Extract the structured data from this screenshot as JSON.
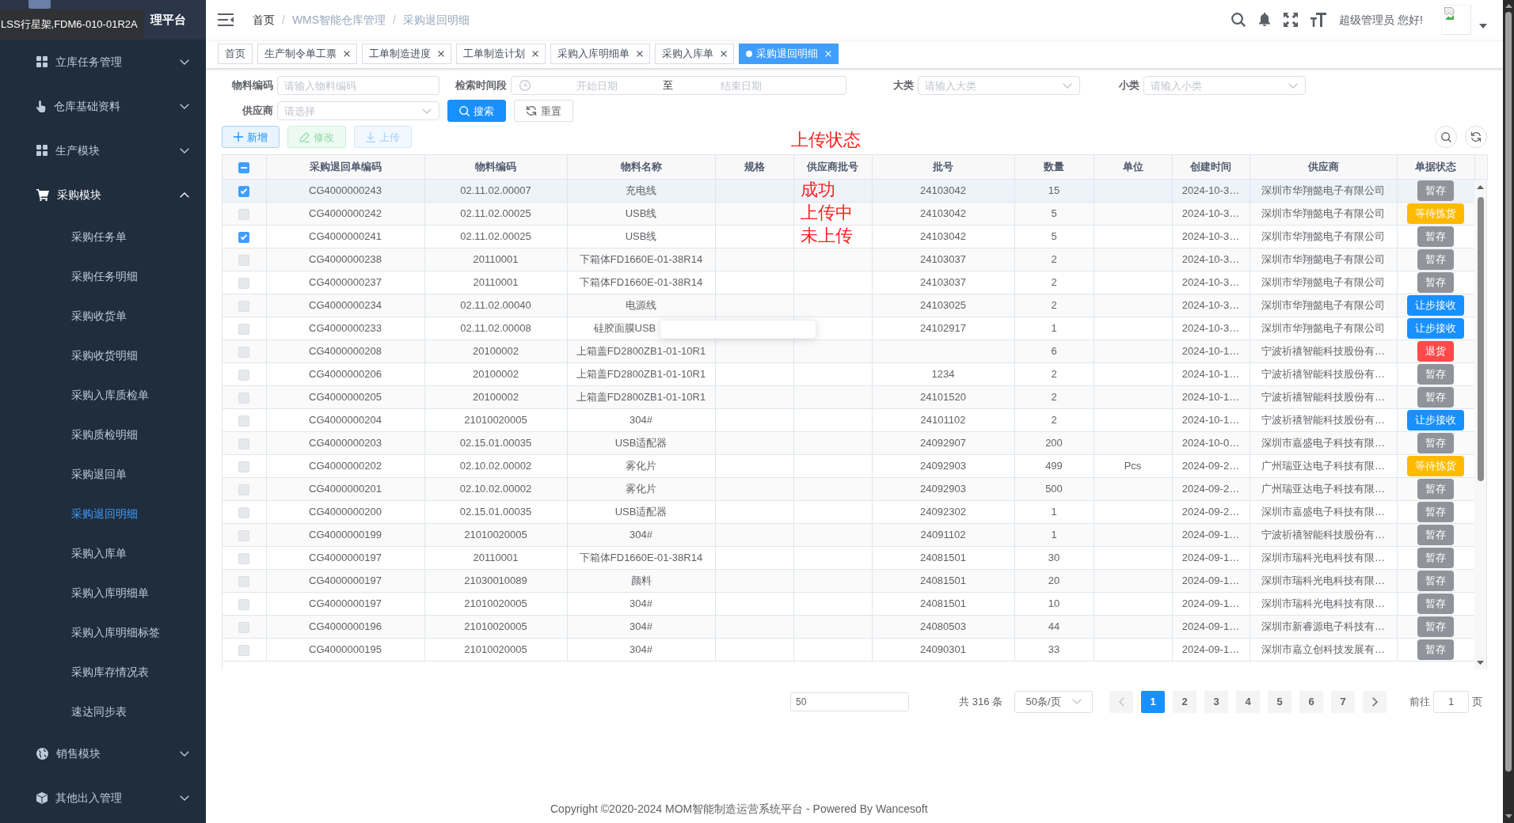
{
  "sidebar": {
    "title": "理平台",
    "tooltip": "LSS行星架,FDM6-010-01R2A",
    "items": [
      {
        "label": "立库任务管理",
        "expanded": false
      },
      {
        "label": "仓库基础资料",
        "expanded": false
      },
      {
        "label": "生产模块",
        "expanded": false
      },
      {
        "label": "采购模块",
        "expanded": true,
        "children": [
          {
            "label": "采购任务单",
            "selected": false
          },
          {
            "label": "采购任务明细",
            "selected": false
          },
          {
            "label": "采购收货单",
            "selected": false
          },
          {
            "label": "采购收货明细",
            "selected": false
          },
          {
            "label": "采购入库质检单",
            "selected": false
          },
          {
            "label": "采购质检明细",
            "selected": false
          },
          {
            "label": "采购退回单",
            "selected": false
          },
          {
            "label": "采购退回明细",
            "selected": true
          },
          {
            "label": "采购入库单",
            "selected": false
          },
          {
            "label": "采购入库明细单",
            "selected": false
          },
          {
            "label": "采购入库明细标签",
            "selected": false
          },
          {
            "label": "采购库存情况表",
            "selected": false
          },
          {
            "label": "速达同步表",
            "selected": false
          }
        ]
      },
      {
        "label": "销售模块",
        "expanded": false
      },
      {
        "label": "其他出入管理",
        "expanded": false
      }
    ]
  },
  "header": {
    "breadcrumb": [
      {
        "label": "首页",
        "link": true
      },
      {
        "separator": "/",
        "label": "WMS智能仓库管理",
        "link": false
      },
      {
        "separator": "/",
        "label": "采购退回明细",
        "link": false
      }
    ],
    "greeting": "超级管理员 您好!"
  },
  "tabs": [
    {
      "label": "首页",
      "closable": false,
      "selected": false
    },
    {
      "label": "生产制令单工票",
      "closable": true,
      "selected": false
    },
    {
      "label": "工单制造进度",
      "closable": true,
      "selected": false
    },
    {
      "label": "工单制造计划",
      "closable": true,
      "selected": false
    },
    {
      "label": "采购入库明细单",
      "closable": true,
      "selected": false
    },
    {
      "label": "采购入库单",
      "closable": true,
      "selected": false
    },
    {
      "label": "采购退回明细",
      "closable": true,
      "selected": true
    }
  ],
  "filters": {
    "rows": [
      [
        {
          "kind": "text",
          "label": "物料编码",
          "placeholder": "请输入物料编码"
        },
        {
          "kind": "daterange",
          "label": "检索时间段",
          "start_placeholder": "开始日期",
          "separator": "至",
          "end_placeholder": "结束日期"
        },
        {
          "kind": "select",
          "label": "大类",
          "placeholder": "请输入大类"
        },
        {
          "kind": "select",
          "label": "小类",
          "placeholder": "请输入小类"
        }
      ],
      [
        {
          "kind": "select",
          "label": "供应商",
          "placeholder": "请选择"
        }
      ]
    ],
    "buttons": [
      {
        "kind": "search",
        "label": "搜索"
      },
      {
        "kind": "reset",
        "label": "重置"
      }
    ]
  },
  "toolbar": {
    "buttons": [
      {
        "kind": "add",
        "label": "新增",
        "disabled": false
      },
      {
        "kind": "edit",
        "label": "修改",
        "disabled": true
      },
      {
        "kind": "upload",
        "label": "上传",
        "disabled": true
      }
    ],
    "annotation": "上传状态"
  },
  "table": {
    "columns": [
      "采购退回单编码",
      "物料编码",
      "物料名称",
      "规格",
      "供应商批号",
      "批号",
      "数量",
      "单位",
      "创建时间",
      "供应商",
      "单据状态"
    ],
    "select_all": {
      "indeterminate": true
    },
    "rows": [
      {
        "checked": true,
        "current": true,
        "tooltip": false,
        "code": "CG4000000243",
        "material_code": "02.11.02.00007",
        "material_name": "充电线",
        "note": "成功",
        "batch": "24103042",
        "qty": "15",
        "created": "2024-10-3…",
        "supplier": "深圳市华翔懿电子有限公司",
        "status": {
          "label": "暂存",
          "color": "#909399"
        }
      },
      {
        "checked": false,
        "current": false,
        "tooltip": false,
        "code": "CG4000000242",
        "material_code": "02.11.02.00025",
        "material_name": "USB线",
        "note": "上传中",
        "batch": "24103042",
        "qty": "5",
        "created": "2024-10-3…",
        "supplier": "深圳市华翔懿电子有限公司",
        "status": {
          "label": "等待拣货",
          "color": "#ffba00"
        }
      },
      {
        "checked": true,
        "current": false,
        "tooltip": false,
        "code": "CG4000000241",
        "material_code": "02.11.02.00025",
        "material_name": "USB线",
        "note": "未上传",
        "batch": "24103042",
        "qty": "5",
        "created": "2024-10-3…",
        "supplier": "深圳市华翔懿电子有限公司",
        "status": {
          "label": "暂存",
          "color": "#909399"
        }
      },
      {
        "checked": false,
        "current": false,
        "tooltip": false,
        "code": "CG4000000238",
        "material_code": "20110001",
        "material_name": "下箱体FD1660E-01-38R14",
        "batch": "24103037",
        "qty": "2",
        "created": "2024-10-3…",
        "supplier": "深圳市华翔懿电子有限公司",
        "status": {
          "label": "暂存",
          "color": "#909399"
        }
      },
      {
        "checked": false,
        "current": false,
        "tooltip": false,
        "code": "CG4000000237",
        "material_code": "20110001",
        "material_name": "下箱体FD1660E-01-38R14",
        "batch": "24103037",
        "qty": "2",
        "created": "2024-10-3…",
        "supplier": "深圳市华翔懿电子有限公司",
        "status": {
          "label": "暂存",
          "color": "#909399"
        }
      },
      {
        "checked": false,
        "current": false,
        "tooltip": false,
        "code": "CG4000000234",
        "material_code": "02.11.02.00040",
        "material_name": "电源线",
        "batch": "24103025",
        "qty": "2",
        "created": "2024-10-3…",
        "supplier": "深圳市华翔懿电子有限公司",
        "status": {
          "label": "让步接收",
          "color": "#1890ff"
        }
      },
      {
        "checked": false,
        "current": false,
        "tooltip": true,
        "code": "CG4000000233",
        "material_code": "02.11.02.00008",
        "material_name": "硅胶面膜USB",
        "batch": "24102917",
        "qty": "1",
        "created": "2024-10-3…",
        "supplier": "深圳市华翔懿电子有限公司",
        "status": {
          "label": "让步接收",
          "color": "#1890ff"
        }
      },
      {
        "checked": false,
        "current": false,
        "tooltip": false,
        "code": "CG4000000208",
        "material_code": "20100002",
        "material_name": "上箱盖FD2800ZB1-01-10R1",
        "qty": "6",
        "created": "2024-10-1…",
        "supplier": "宁波祈禧智能科技股份有…",
        "status": {
          "label": "退货",
          "color": "#ff4949"
        }
      },
      {
        "checked": false,
        "current": false,
        "tooltip": false,
        "code": "CG4000000206",
        "material_code": "20100002",
        "material_name": "上箱盖FD2800ZB1-01-10R1",
        "batch": "1234",
        "qty": "2",
        "created": "2024-10-1…",
        "supplier": "宁波祈禧智能科技股份有…",
        "status": {
          "label": "暂存",
          "color": "#909399"
        }
      },
      {
        "checked": false,
        "current": false,
        "tooltip": false,
        "code": "CG4000000205",
        "material_code": "20100002",
        "material_name": "上箱盖FD2800ZB1-01-10R1",
        "batch": "24101520",
        "qty": "2",
        "created": "2024-10-1…",
        "supplier": "宁波祈禧智能科技股份有…",
        "status": {
          "label": "暂存",
          "color": "#909399"
        }
      },
      {
        "checked": false,
        "current": false,
        "tooltip": false,
        "code": "CG4000000204",
        "material_code": "21010020005",
        "material_name": "304#",
        "batch": "24101102",
        "qty": "2",
        "created": "2024-10-1…",
        "supplier": "宁波祈禧智能科技股份有…",
        "status": {
          "label": "让步接收",
          "color": "#1890ff"
        }
      },
      {
        "checked": false,
        "current": false,
        "tooltip": false,
        "code": "CG4000000203",
        "material_code": "02.15.01.00035",
        "material_name": "USB适配器",
        "batch": "24092907",
        "qty": "200",
        "created": "2024-10-0…",
        "supplier": "深圳市嘉盛电子科技有限…",
        "status": {
          "label": "暂存",
          "color": "#909399"
        }
      },
      {
        "checked": false,
        "current": false,
        "tooltip": false,
        "code": "CG4000000202",
        "material_code": "02.10.02.00002",
        "material_name": "雾化片",
        "batch": "24092903",
        "qty": "499",
        "unit": "Pcs",
        "created": "2024-09-2…",
        "supplier": "广州瑞亚达电子科技有限…",
        "status": {
          "label": "等待拣货",
          "color": "#ffba00"
        }
      },
      {
        "checked": false,
        "current": false,
        "tooltip": false,
        "code": "CG4000000201",
        "material_code": "02.10.02.00002",
        "material_name": "雾化片",
        "batch": "24092903",
        "qty": "500",
        "created": "2024-09-2…",
        "supplier": "广州瑞亚达电子科技有限…",
        "status": {
          "label": "暂存",
          "color": "#909399"
        }
      },
      {
        "checked": false,
        "current": false,
        "tooltip": false,
        "code": "CG4000000200",
        "material_code": "02.15.01.00035",
        "material_name": "USB适配器",
        "batch": "24092302",
        "qty": "1",
        "created": "2024-09-2…",
        "supplier": "深圳市嘉盛电子科技有限…",
        "status": {
          "label": "暂存",
          "color": "#909399"
        }
      },
      {
        "checked": false,
        "current": false,
        "tooltip": false,
        "code": "CG4000000199",
        "material_code": "21010020005",
        "material_name": "304#",
        "batch": "24091102",
        "qty": "1",
        "created": "2024-09-1…",
        "supplier": "宁波祈禧智能科技股份有…",
        "status": {
          "label": "暂存",
          "color": "#909399"
        }
      },
      {
        "checked": false,
        "current": false,
        "tooltip": false,
        "code": "CG4000000197",
        "material_code": "20110001",
        "material_name": "下箱体FD1660E-01-38R14",
        "batch": "24081501",
        "qty": "30",
        "created": "2024-09-1…",
        "supplier": "深圳市瑞科光电科技有限…",
        "status": {
          "label": "暂存",
          "color": "#909399"
        }
      },
      {
        "checked": false,
        "current": false,
        "tooltip": false,
        "code": "CG4000000197",
        "material_code": "21030010089",
        "material_name": "颜料",
        "batch": "24081501",
        "qty": "20",
        "created": "2024-09-1…",
        "supplier": "深圳市瑞科光电科技有限…",
        "status": {
          "label": "暂存",
          "color": "#909399"
        }
      },
      {
        "checked": false,
        "current": false,
        "tooltip": false,
        "code": "CG4000000197",
        "material_code": "21010020005",
        "material_name": "304#",
        "batch": "24081501",
        "qty": "10",
        "created": "2024-09-1…",
        "supplier": "深圳市瑞科光电科技有限…",
        "status": {
          "label": "暂存",
          "color": "#909399"
        }
      },
      {
        "checked": false,
        "current": false,
        "tooltip": false,
        "code": "CG4000000196",
        "material_code": "21010020005",
        "material_name": "304#",
        "batch": "24080503",
        "qty": "44",
        "created": "2024-09-1…",
        "supplier": "深圳市新睿源电子科技有…",
        "status": {
          "label": "暂存",
          "color": "#909399"
        }
      },
      {
        "checked": false,
        "current": false,
        "tooltip": false,
        "code": "CG4000000195",
        "material_code": "21010020005",
        "material_name": "304#",
        "batch": "24090301",
        "qty": "33",
        "created": "2024-09-1…",
        "supplier": "深圳市嘉立创科技发展有…",
        "status": {
          "label": "暂存",
          "color": "#909399"
        }
      }
    ]
  },
  "pagination": {
    "input_value": "50",
    "total": "共 316 条",
    "page_size": "50条/页",
    "prev_disabled": true,
    "pages": [
      {
        "label": "1",
        "selected": true
      },
      {
        "label": "2",
        "selected": false
      },
      {
        "label": "3",
        "selected": false
      },
      {
        "label": "4",
        "selected": false
      },
      {
        "label": "5",
        "selected": false
      },
      {
        "label": "6",
        "selected": false
      },
      {
        "label": "7",
        "selected": false
      }
    ],
    "next_disabled": false,
    "goto_label": "前往",
    "goto_value": "1",
    "goto_suffix": "页"
  },
  "footer": "Copyright ©2020-2024 MOM智能制造运营系统平台 - Powered By Wancesoft"
}
